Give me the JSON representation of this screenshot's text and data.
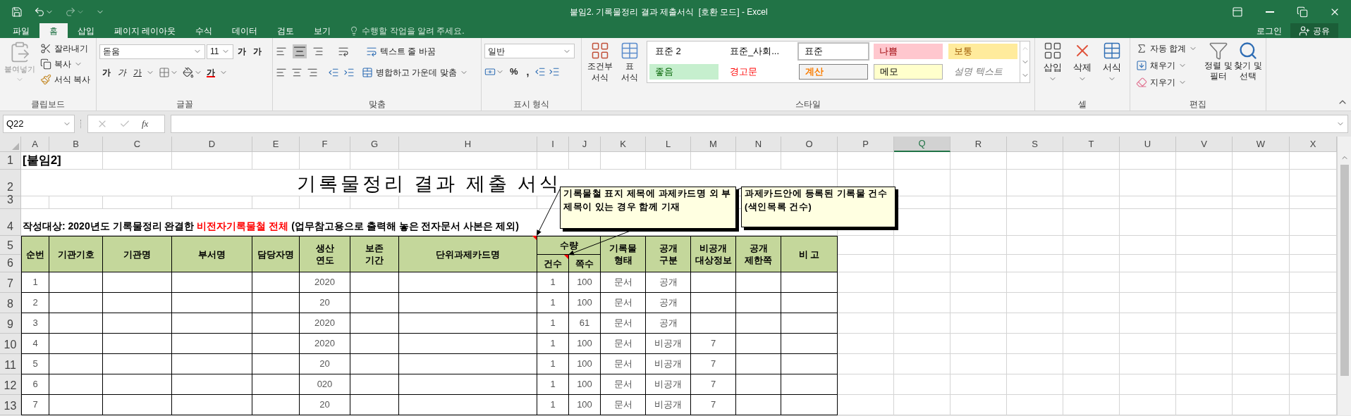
{
  "window": {
    "title": "붙임2. 기록물정리 결과 제출서식  [호환 모드] - Excel"
  },
  "menu_tabs": [
    {
      "label": "파일",
      "selected": false
    },
    {
      "label": "홈",
      "selected": true
    },
    {
      "label": "삽입",
      "selected": false
    },
    {
      "label": "페이지 레이아웃",
      "selected": false
    },
    {
      "label": "수식",
      "selected": false
    },
    {
      "label": "데이터",
      "selected": false
    },
    {
      "label": "검토",
      "selected": false
    },
    {
      "label": "보기",
      "selected": false
    }
  ],
  "tell_me": {
    "placeholder": "수행할 작업을 알려 주세요."
  },
  "account": {
    "sign_in": "로그인",
    "share": "공유"
  },
  "ribbon": {
    "clipboard": {
      "paste": "붙여넣기",
      "cut": "잘라내기",
      "copy": "복사",
      "format_painter": "서식 복사",
      "label": "클립보드"
    },
    "font": {
      "name": "돋움",
      "size": "11",
      "grow": "가",
      "shrink": "가",
      "bold": "가",
      "italic": "가",
      "underline": "가",
      "font_color": "가",
      "label": "글꼴"
    },
    "alignment": {
      "wrap_text": "텍스트 줄 바꿈",
      "merge_center": "병합하고 가운데 맞춤",
      "label": "맞춤"
    },
    "number": {
      "format": "일반",
      "percent": "%",
      "comma": ",",
      "label": "표시 형식"
    },
    "styles": {
      "conditional": "조건부 서식",
      "format_table": "표 서식",
      "label": "스타일",
      "gallery": [
        {
          "label": "표준 2",
          "kind": "plain",
          "selected": false
        },
        {
          "label": "표준_사회...",
          "kind": "plain",
          "selected": false
        },
        {
          "label": "표준",
          "kind": "plain",
          "selected": true
        },
        {
          "label": "나쁨",
          "kind": "bad",
          "selected": false
        },
        {
          "label": "보통",
          "kind": "neutral",
          "selected": false
        },
        {
          "label": "좋음",
          "kind": "good",
          "selected": false
        },
        {
          "label": "경고문",
          "kind": "warning",
          "selected": false
        },
        {
          "label": "계산",
          "kind": "calculation",
          "selected": false
        },
        {
          "label": "메모",
          "kind": "note",
          "selected": false
        },
        {
          "label": "설명 텍스트",
          "kind": "explanatory",
          "selected": false
        }
      ]
    },
    "cells": {
      "insert": "삽입",
      "delete": "삭제",
      "format": "서식",
      "label": "셀"
    },
    "editing": {
      "autosum": "자동 합계",
      "fill": "채우기",
      "clear": "지우기",
      "sort_filter": "정렬 및 필터",
      "find_select": "찾기 및 선택",
      "label": "편집"
    }
  },
  "formula_bar": {
    "name_box": "Q22",
    "function_label": "fx"
  },
  "sheet": {
    "columns": [
      {
        "label": "A",
        "selected": false
      },
      {
        "label": "B",
        "selected": false
      },
      {
        "label": "C",
        "selected": false
      },
      {
        "label": "D",
        "selected": false
      },
      {
        "label": "E",
        "selected": false
      },
      {
        "label": "F",
        "selected": false
      },
      {
        "label": "G",
        "selected": false
      },
      {
        "label": "H",
        "selected": false
      },
      {
        "label": "I",
        "selected": false
      },
      {
        "label": "J",
        "selected": false
      },
      {
        "label": "K",
        "selected": false
      },
      {
        "label": "L",
        "selected": false
      },
      {
        "label": "M",
        "selected": false
      },
      {
        "label": "N",
        "selected": false
      },
      {
        "label": "O",
        "selected": false
      },
      {
        "label": "P",
        "selected": false
      },
      {
        "label": "Q",
        "selected": true
      },
      {
        "label": "R",
        "selected": false
      },
      {
        "label": "S",
        "selected": false
      },
      {
        "label": "T",
        "selected": false
      },
      {
        "label": "U",
        "selected": false
      },
      {
        "label": "V",
        "selected": false
      },
      {
        "label": "W",
        "selected": false
      },
      {
        "label": "X",
        "selected": false
      }
    ],
    "row_numbers": [
      "1",
      "2",
      "3",
      "4",
      "5",
      "6",
      "7",
      "8",
      "9",
      "10",
      "11",
      "12",
      "13"
    ],
    "attachment_label": "[붙임2]",
    "title": "기록물정리 결과 제출 서식",
    "target_note": [
      {
        "text": "작성대상: 2020년도 기록물정리 완결한 ",
        "emphasis": false
      },
      {
        "text": "비전자기록물철 전체",
        "emphasis": true
      },
      {
        "text": " (업무참고용으로 출력해 놓은 전자문서 사본은 제외)",
        "emphasis": false
      }
    ],
    "headers": [
      {
        "label": "순번",
        "kind": "single"
      },
      {
        "label": "기관기호",
        "kind": "single"
      },
      {
        "label": "기관명",
        "kind": "single"
      },
      {
        "label": "부서명",
        "kind": "single"
      },
      {
        "label": "담당자명",
        "kind": "single"
      },
      {
        "label": "생산\n연도",
        "kind": "single"
      },
      {
        "label": "보존\n기간",
        "kind": "single"
      },
      {
        "label": "단위과제카드명",
        "kind": "single"
      },
      {
        "label": "수량",
        "kind": "group",
        "children": [
          "건수",
          "쪽수"
        ]
      },
      {
        "label": "기록물\n형태",
        "kind": "single"
      },
      {
        "label": "공개\n구분",
        "kind": "single"
      },
      {
        "label": "비공개\n대상정보",
        "kind": "single"
      },
      {
        "label": "공개\n제한쪽",
        "kind": "single"
      },
      {
        "label": "비 고",
        "kind": "single"
      }
    ],
    "data_rows": [
      {
        "number": "1",
        "year": "2020",
        "count": "1",
        "pages": "100",
        "form": "문서",
        "disclosure": "공개"
      },
      {
        "number": "2",
        "year": "20",
        "count": "1",
        "pages": "100",
        "form": "문서",
        "disclosure": "공개"
      },
      {
        "number": "3",
        "year": "2020",
        "count": "1",
        "pages": "61",
        "form": "문서",
        "disclosure": "공개"
      },
      {
        "number": "4",
        "year": "2020",
        "count": "1",
        "pages": "100",
        "form": "문서",
        "disclosure": "비공개",
        "nondisclosure": "7"
      },
      {
        "number": "5",
        "year": "20",
        "count": "1",
        "pages": "100",
        "form": "문서",
        "disclosure": "비공개",
        "nondisclosure": "7"
      },
      {
        "number": "6",
        "year": "020",
        "count": "1",
        "pages": "100",
        "form": "문서",
        "disclosure": "비공개",
        "nondisclosure": "7"
      },
      {
        "number": "7",
        "year": "20",
        "count": "1",
        "pages": "100",
        "form": "문서",
        "disclosure": "비공개",
        "nondisclosure": "7"
      }
    ],
    "comments": [
      {
        "text": "기록물철 표지 제목에 과제카드명 외 부제목이 있는 경우 함께 기재"
      },
      {
        "text": "과제카드안에 등록된 기록물 건수 (색인목록 건수)"
      }
    ]
  }
}
